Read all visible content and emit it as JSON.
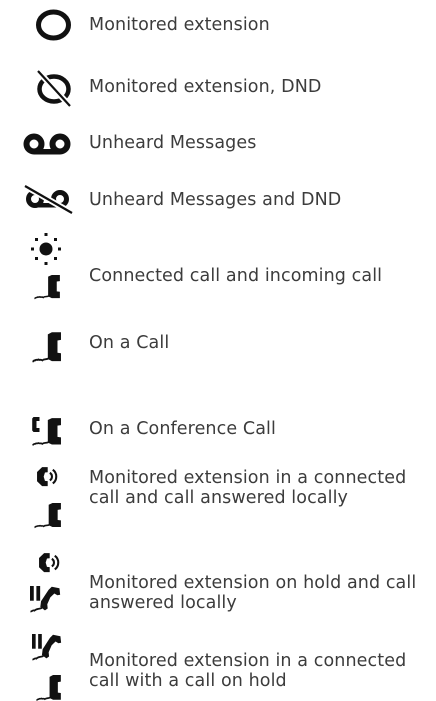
{
  "legend": {
    "items": [
      {
        "icon": "monitored-extension-icon",
        "label": "Monitored extension"
      },
      {
        "icon": "monitored-extension-dnd-icon",
        "label": "Monitored extension, DND"
      },
      {
        "icon": "voicemail-icon",
        "label": "Unheard Messages"
      },
      {
        "icon": "voicemail-dnd-icon",
        "label": "Unheard Messages and DND"
      },
      {
        "icon": "ringing-connected-call-icon",
        "label": "Connected call and incoming call"
      },
      {
        "icon": "phone-handset-icon",
        "label": "On a Call"
      },
      {
        "icon": "conference-call-icon",
        "label": "On a Conference Call"
      },
      {
        "icon": "connected-answered-locally-icon",
        "label": "Monitored extension in a connected call and call answered locally"
      },
      {
        "icon": "hold-answered-locally-icon",
        "label": "Monitored extension on hold and call answered locally"
      },
      {
        "icon": "connected-call-on-hold-icon",
        "label": "Monitored extension in a connected call with a call on hold"
      }
    ]
  }
}
